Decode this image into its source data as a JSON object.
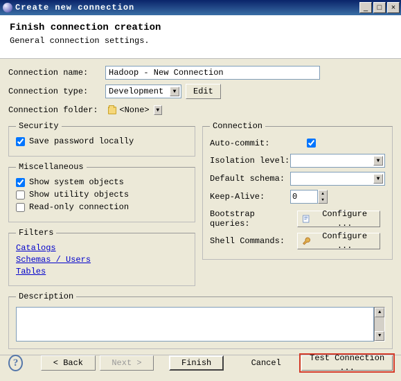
{
  "window": {
    "title": "Create new connection"
  },
  "header": {
    "title": "Finish connection creation",
    "subtitle": "General connection settings."
  },
  "fields": {
    "name_label": "Connection name:",
    "name_value": "Hadoop - New Connection",
    "type_label": "Connection type:",
    "type_value": "Development",
    "edit_btn": "Edit",
    "folder_label": "Connection folder:",
    "folder_value": "<None>"
  },
  "security": {
    "legend": "Security",
    "save_pw": "Save password locally",
    "save_pw_checked": true
  },
  "misc": {
    "legend": "Miscellaneous",
    "show_sys": "Show system objects",
    "show_sys_checked": true,
    "show_util": "Show utility objects",
    "show_util_checked": false,
    "read_only": "Read-only connection",
    "read_only_checked": false
  },
  "filters": {
    "legend": "Filters",
    "catalogs": "Catalogs",
    "schemas": "Schemas / Users",
    "tables": "Tables"
  },
  "connection": {
    "legend": "Connection",
    "auto_commit": "Auto-commit:",
    "auto_commit_checked": true,
    "isolation": "Isolation level:",
    "isolation_value": "",
    "schema": "Default schema:",
    "schema_value": "",
    "keep_alive": "Keep-Alive:",
    "keep_alive_value": "0",
    "bootstrap": "Bootstrap queries:",
    "shell": "Shell Commands:",
    "configure": "Configure ..."
  },
  "description": {
    "legend": "Description",
    "value": ""
  },
  "footer": {
    "back": "< Back",
    "next": "Next >",
    "finish": "Finish",
    "cancel": "Cancel",
    "test": "Test Connection ..."
  }
}
